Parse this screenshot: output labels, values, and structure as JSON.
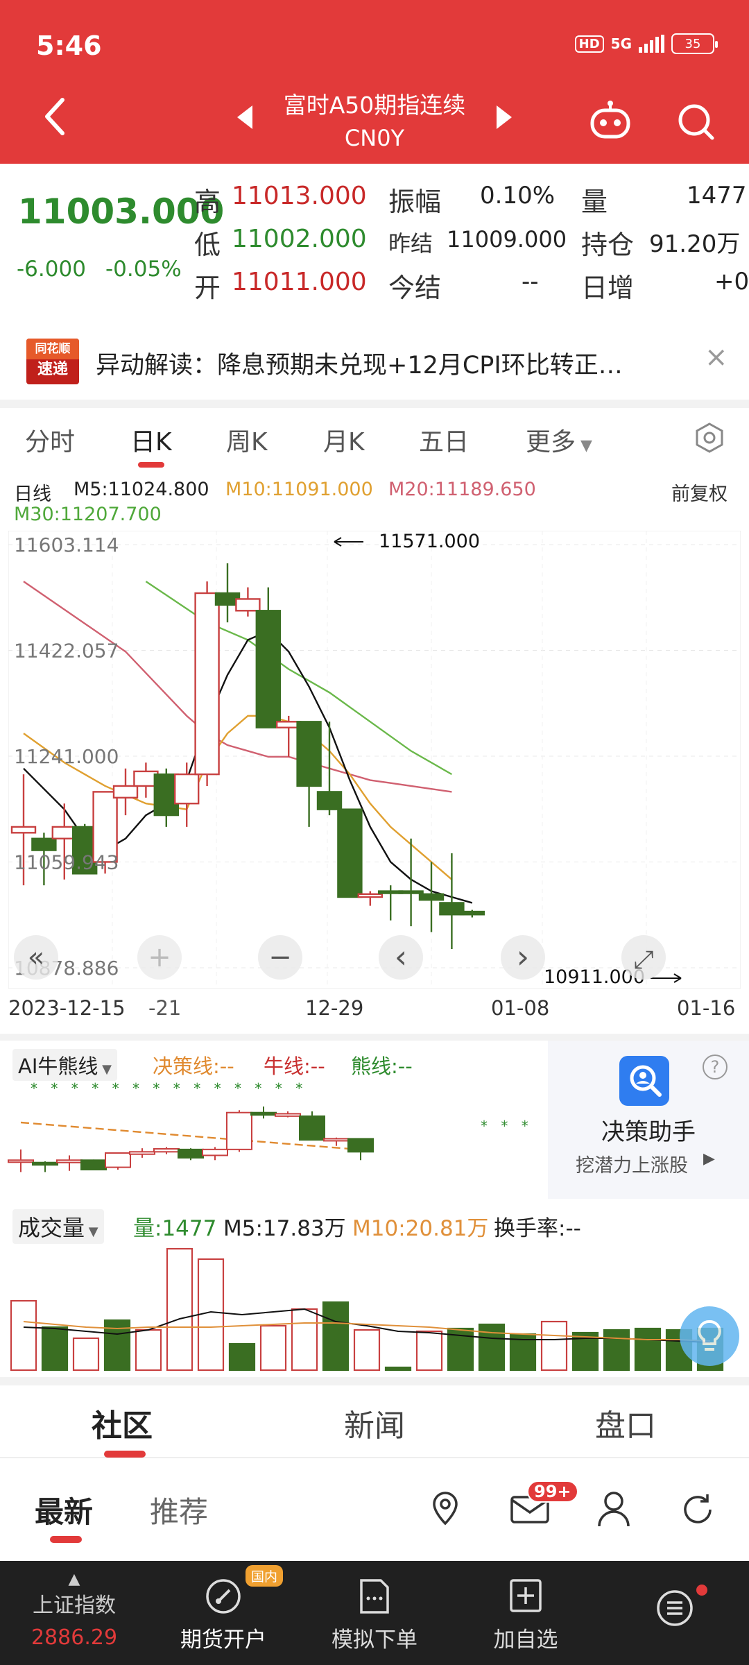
{
  "status": {
    "time": "5:46",
    "hd": "HD",
    "network": "5G",
    "battery": "35"
  },
  "header": {
    "title": "富时A50期指连续",
    "code": "CN0Y"
  },
  "quote": {
    "price": "11003.000",
    "change": "-6.000",
    "change_pct": "-0.05%",
    "high_label": "高",
    "high": "11013.000",
    "low_label": "低",
    "low": "11002.000",
    "open_label": "开",
    "open": "11011.000",
    "amp_label": "振幅",
    "amp": "0.10%",
    "prev_settle_label": "昨结",
    "prev_settle": "11009.000",
    "settle_label": "今结",
    "settle": "--",
    "vol_label": "量",
    "vol": "1477",
    "oi_label": "持仓",
    "oi": "91.20万",
    "day_inc_label": "日增",
    "day_inc": "+0"
  },
  "news": {
    "logo_line1": "同花顺",
    "logo_line2": "速递",
    "text": "异动解读：降息预期未兑现+12月CPI环比转正…",
    "close": "×"
  },
  "tabs": [
    "分时",
    "日K",
    "周K",
    "月K",
    "五日",
    "更多"
  ],
  "ma": {
    "label": "日线",
    "m5": "M5:11024.800",
    "m10": "M10:11091.000",
    "m20": "M20:11189.650",
    "m30": "M30:11207.700",
    "adjust": "前复权"
  },
  "chart_data": {
    "type": "candlestick",
    "y_ticks": [
      "11603.114",
      "11422.057",
      "11241.000",
      "11059.943",
      "10878.886"
    ],
    "x_ticks": [
      "2023-12-15",
      "21",
      "12-29",
      "01-08",
      "01-16"
    ],
    "annot_high": "11571.000",
    "annot_low": "10911.000",
    "ylim": [
      10878.886,
      11603.114
    ],
    "candles": [
      {
        "o": 11110,
        "h": 11210,
        "l": 11020,
        "c": 11120,
        "up": true
      },
      {
        "o": 11100,
        "h": 11110,
        "l": 11020,
        "c": 11080,
        "up": false
      },
      {
        "o": 11100,
        "h": 11160,
        "l": 11030,
        "c": 11120,
        "up": true
      },
      {
        "o": 11120,
        "h": 11125,
        "l": 11040,
        "c": 11040,
        "up": false
      },
      {
        "o": 11060,
        "h": 11180,
        "l": 11040,
        "c": 11180,
        "up": true
      },
      {
        "o": 11170,
        "h": 11220,
        "l": 11140,
        "c": 11190,
        "up": true
      },
      {
        "o": 11190,
        "h": 11230,
        "l": 11170,
        "c": 11215,
        "up": true
      },
      {
        "o": 11210,
        "h": 11220,
        "l": 11120,
        "c": 11140,
        "up": false
      },
      {
        "o": 11160,
        "h": 11230,
        "l": 11120,
        "c": 11210,
        "up": true
      },
      {
        "o": 11210,
        "h": 11540,
        "l": 11190,
        "c": 11520,
        "up": true
      },
      {
        "o": 11520,
        "h": 11571,
        "l": 11470,
        "c": 11500,
        "up": false
      },
      {
        "o": 11490,
        "h": 11530,
        "l": 11480,
        "c": 11510,
        "up": true
      },
      {
        "o": 11490,
        "h": 11530,
        "l": 11290,
        "c": 11290,
        "up": false
      },
      {
        "o": 11290,
        "h": 11310,
        "l": 11240,
        "c": 11300,
        "up": true
      },
      {
        "o": 11300,
        "h": 11300,
        "l": 11120,
        "c": 11190,
        "up": false
      },
      {
        "o": 11180,
        "h": 11300,
        "l": 11140,
        "c": 11150,
        "up": false
      },
      {
        "o": 11150,
        "h": 11150,
        "l": 11000,
        "c": 11000,
        "up": false
      },
      {
        "o": 11000,
        "h": 11010,
        "l": 10985,
        "c": 11005,
        "up": true
      },
      {
        "o": 11008,
        "h": 11020,
        "l": 10960,
        "c": 11010,
        "up": false
      },
      {
        "o": 11010,
        "h": 11100,
        "l": 10950,
        "c": 11010,
        "up": false
      },
      {
        "o": 11005,
        "h": 11060,
        "l": 10940,
        "c": 10995,
        "up": false
      },
      {
        "o": 10990,
        "h": 11075,
        "l": 10911,
        "c": 10970,
        "up": false
      },
      {
        "o": 10975,
        "h": 10978,
        "l": 10965,
        "c": 10970,
        "up": false
      }
    ],
    "ma5": [
      11220,
      null,
      11150,
      11100,
      11080,
      11100,
      11140,
      11160,
      11200,
      11300,
      11380,
      11440,
      11455,
      11420,
      11360,
      11290,
      11200,
      11120,
      11060,
      11030,
      11010,
      11000,
      10990
    ],
    "ma10": [
      11280,
      null,
      11230,
      null,
      11190,
      null,
      11160,
      null,
      11150,
      11230,
      11280,
      11310,
      11310,
      11300,
      11280,
      11250,
      11210,
      11160,
      11120,
      11090,
      11060,
      11030
    ],
    "ma20": [
      11540,
      null,
      null,
      null,
      null,
      11420,
      null,
      null,
      11310,
      11280,
      11260,
      11250,
      11240,
      11240,
      11230,
      11220,
      11210,
      11200,
      11195,
      11190,
      11185,
      11180
    ],
    "ma30": [
      null,
      null,
      null,
      null,
      null,
      null,
      11540,
      null,
      null,
      11470,
      null,
      11440,
      null,
      11390,
      null,
      11350,
      null,
      11300,
      null,
      11250,
      null,
      11210
    ]
  },
  "nav_buttons": {
    "first": "«",
    "plus": "+",
    "minus": "−",
    "prev": "‹",
    "next": "›",
    "full": "⤢"
  },
  "ai": {
    "label": "AI牛熊线",
    "decision": "决策线:--",
    "bull": "牛线:--",
    "bear": "熊线:--",
    "assistant_title": "决策助手",
    "assistant_sub": "挖潜力上涨股",
    "help": "?"
  },
  "volume": {
    "label": "成交量",
    "qty": "量:1477",
    "m5": "M5:17.83万",
    "m10": "M10:20.81万",
    "turnover": "换手率:--"
  },
  "community": {
    "tabs": [
      "社区",
      "新闻",
      "盘口"
    ],
    "sub_tabs": [
      "最新",
      "推荐"
    ],
    "mail_badge": "99+"
  },
  "bottom": {
    "index_name": "上证指数",
    "index_value": "2886.29",
    "items": [
      "期货开户",
      "模拟下单",
      "加自选"
    ],
    "futures_badge": "国内"
  },
  "colors": {
    "brand": "#e23a3a",
    "up": "#c84040",
    "down": "#3a6e22",
    "ma5": "#111111",
    "ma10": "#e0a030",
    "ma20": "#d06070",
    "ma30": "#6ab84a"
  }
}
